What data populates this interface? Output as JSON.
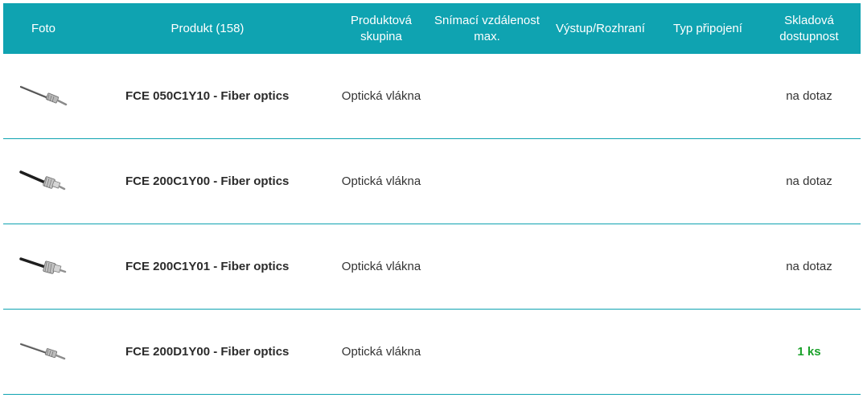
{
  "header": {
    "foto": "Foto",
    "product": "Produkt (158)",
    "group": "Produktová skupina",
    "distance": "Snímací vzdálenost max.",
    "output": "Výstup/Rozhraní",
    "connection": "Typ připojení",
    "stock": "Skladová dostupnost"
  },
  "rows": [
    {
      "image_icon": "fiber-optic-sensor-thin-icon",
      "name": "FCE 050C1Y10 - Fiber optics",
      "group": "Optická vlákna",
      "distance": "",
      "output": "",
      "connection": "",
      "stock": "na dotaz"
    },
    {
      "image_icon": "fiber-optic-sensor-icon",
      "name": "FCE 200C1Y00 - Fiber optics",
      "group": "Optická vlákna",
      "distance": "",
      "output": "",
      "connection": "",
      "stock": "na dotaz"
    },
    {
      "image_icon": "fiber-optic-sensor-icon",
      "name": "FCE 200C1Y01 - Fiber optics",
      "group": "Optická vlákna",
      "distance": "",
      "output": "",
      "connection": "",
      "stock": "na dotaz"
    },
    {
      "image_icon": "fiber-optic-sensor-thin-icon",
      "name": "FCE 200D1Y00 - Fiber optics",
      "group": "Optická vlákna",
      "distance": "",
      "output": "",
      "connection": "",
      "stock": "1 ks"
    }
  ],
  "colors": {
    "header_bg": "#0fa3b1",
    "row_divider": "#0fa3b1",
    "stock_available": "#1aa12a"
  }
}
